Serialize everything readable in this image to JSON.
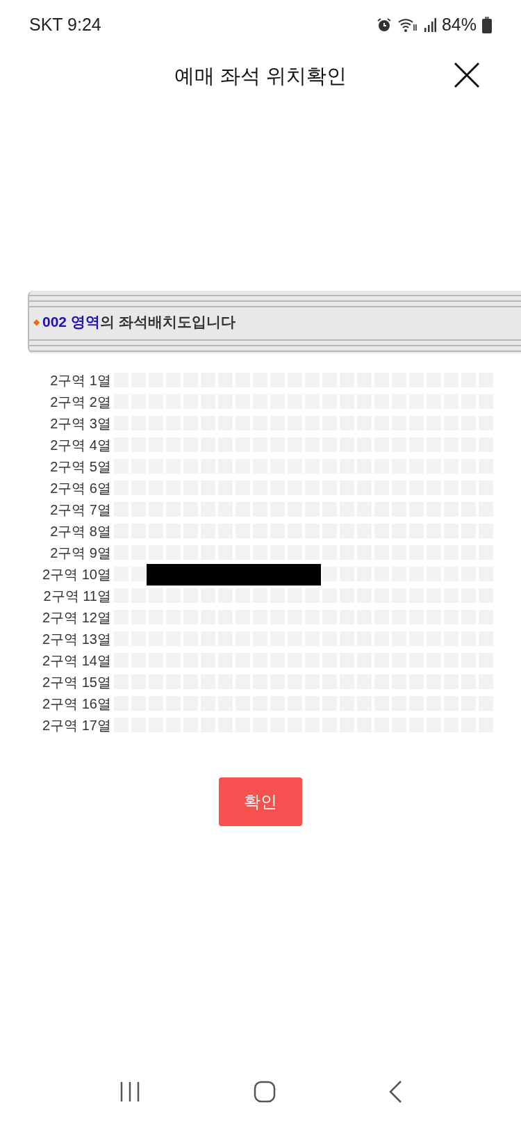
{
  "status_bar": {
    "carrier_time": "SKT 9:24",
    "battery": "84%"
  },
  "header": {
    "title": "예매 좌석 위치확인"
  },
  "banner": {
    "bullet": "◆",
    "text": "**002 영역**의 좌석배치도입니다"
  },
  "seat_rows": [
    {
      "label": "2구역 1열",
      "redacted": false
    },
    {
      "label": "2구역 2열",
      "redacted": false
    },
    {
      "label": "2구역 3열",
      "redacted": false
    },
    {
      "label": "2구역 4열",
      "redacted": false
    },
    {
      "label": "2구역 5열",
      "redacted": false
    },
    {
      "label": "2구역 6열",
      "redacted": false
    },
    {
      "label": "2구역 7열",
      "redacted": false
    },
    {
      "label": "2구역 8열",
      "redacted": false
    },
    {
      "label": "2구역 9열",
      "redacted": false
    },
    {
      "label": "2구역 10열",
      "redacted": true
    },
    {
      "label": "2구역 11열",
      "redacted": false
    },
    {
      "label": "2구역 12열",
      "redacted": false
    },
    {
      "label": "2구역 13열",
      "redacted": false
    },
    {
      "label": "2구역 14열",
      "redacted": false
    },
    {
      "label": "2구역 15열",
      "redacted": false
    },
    {
      "label": "2구역 16열",
      "redacted": false
    },
    {
      "label": "2구역 17열",
      "redacted": false
    }
  ],
  "confirm_button": "확인"
}
